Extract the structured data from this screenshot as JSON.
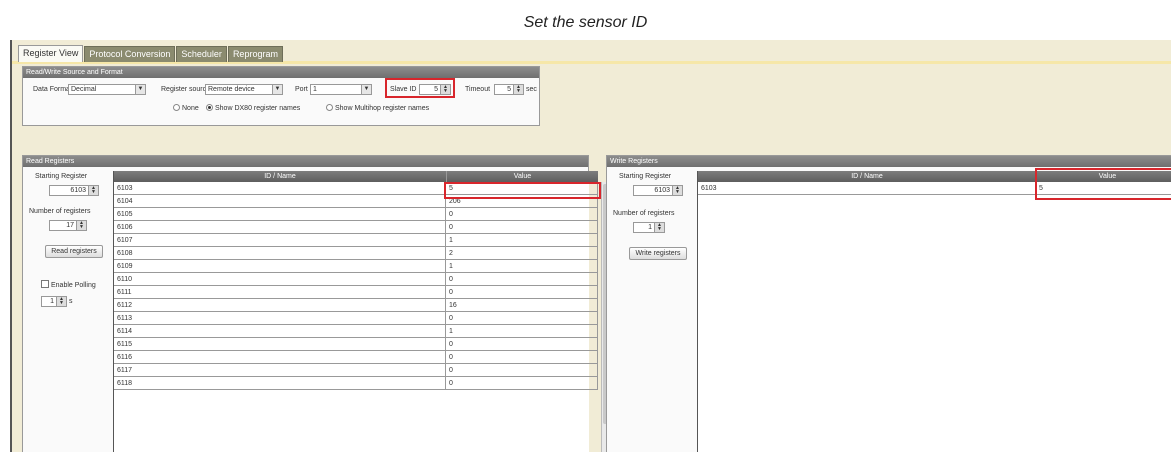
{
  "caption": "Set the sensor ID",
  "tabs": [
    {
      "label": "Register View",
      "active": true
    },
    {
      "label": "Protocol Conversion",
      "active": false
    },
    {
      "label": "Scheduler",
      "active": false
    },
    {
      "label": "Reprogram",
      "active": false
    }
  ],
  "source_format": {
    "title": "Read/Write Source and Format",
    "data_format_label": "Data Format",
    "data_format_value": "Decimal",
    "register_source_label": "Register source",
    "register_source_value": "Remote device",
    "port_label": "Port",
    "port_value": "1",
    "slave_id_label": "Slave ID",
    "slave_id_value": "5",
    "timeout_label": "Timeout",
    "timeout_value": "5",
    "timeout_unit": "sec",
    "radio_none": "None",
    "radio_dx80": "Show DX80 register names",
    "radio_multihop": "Show Multihop register names",
    "selected_radio": "dx80"
  },
  "read_registers": {
    "title": "Read Registers",
    "starting_register_label": "Starting Register",
    "starting_register_value": "6103",
    "number_label": "Number of registers",
    "number_value": "17",
    "read_button": "Read registers",
    "polling_label": "Enable Polling",
    "polling_checked": false,
    "polling_interval": "1",
    "polling_unit": "s",
    "columns": [
      "ID / Name",
      "Value"
    ],
    "rows": [
      {
        "id": "6103",
        "value": "5"
      },
      {
        "id": "6104",
        "value": "206"
      },
      {
        "id": "6105",
        "value": "0"
      },
      {
        "id": "6106",
        "value": "0"
      },
      {
        "id": "6107",
        "value": "1"
      },
      {
        "id": "6108",
        "value": "2"
      },
      {
        "id": "6109",
        "value": "1"
      },
      {
        "id": "6110",
        "value": "0"
      },
      {
        "id": "6111",
        "value": "0"
      },
      {
        "id": "6112",
        "value": "16"
      },
      {
        "id": "6113",
        "value": "0"
      },
      {
        "id": "6114",
        "value": "1"
      },
      {
        "id": "6115",
        "value": "0"
      },
      {
        "id": "6116",
        "value": "0"
      },
      {
        "id": "6117",
        "value": "0"
      },
      {
        "id": "6118",
        "value": "0"
      }
    ]
  },
  "write_registers": {
    "title": "Write Registers",
    "starting_register_label": "Starting Register",
    "starting_register_value": "6103",
    "number_label": "Number of registers",
    "number_value": "1",
    "write_button": "Write registers",
    "columns": [
      "ID / Name",
      "Value"
    ],
    "rows": [
      {
        "id": "6103",
        "value": "5"
      }
    ]
  },
  "colors": {
    "highlight": "#d8262c",
    "window_bg": "#f1ecd6",
    "header_gray": "#6f6f6f"
  }
}
